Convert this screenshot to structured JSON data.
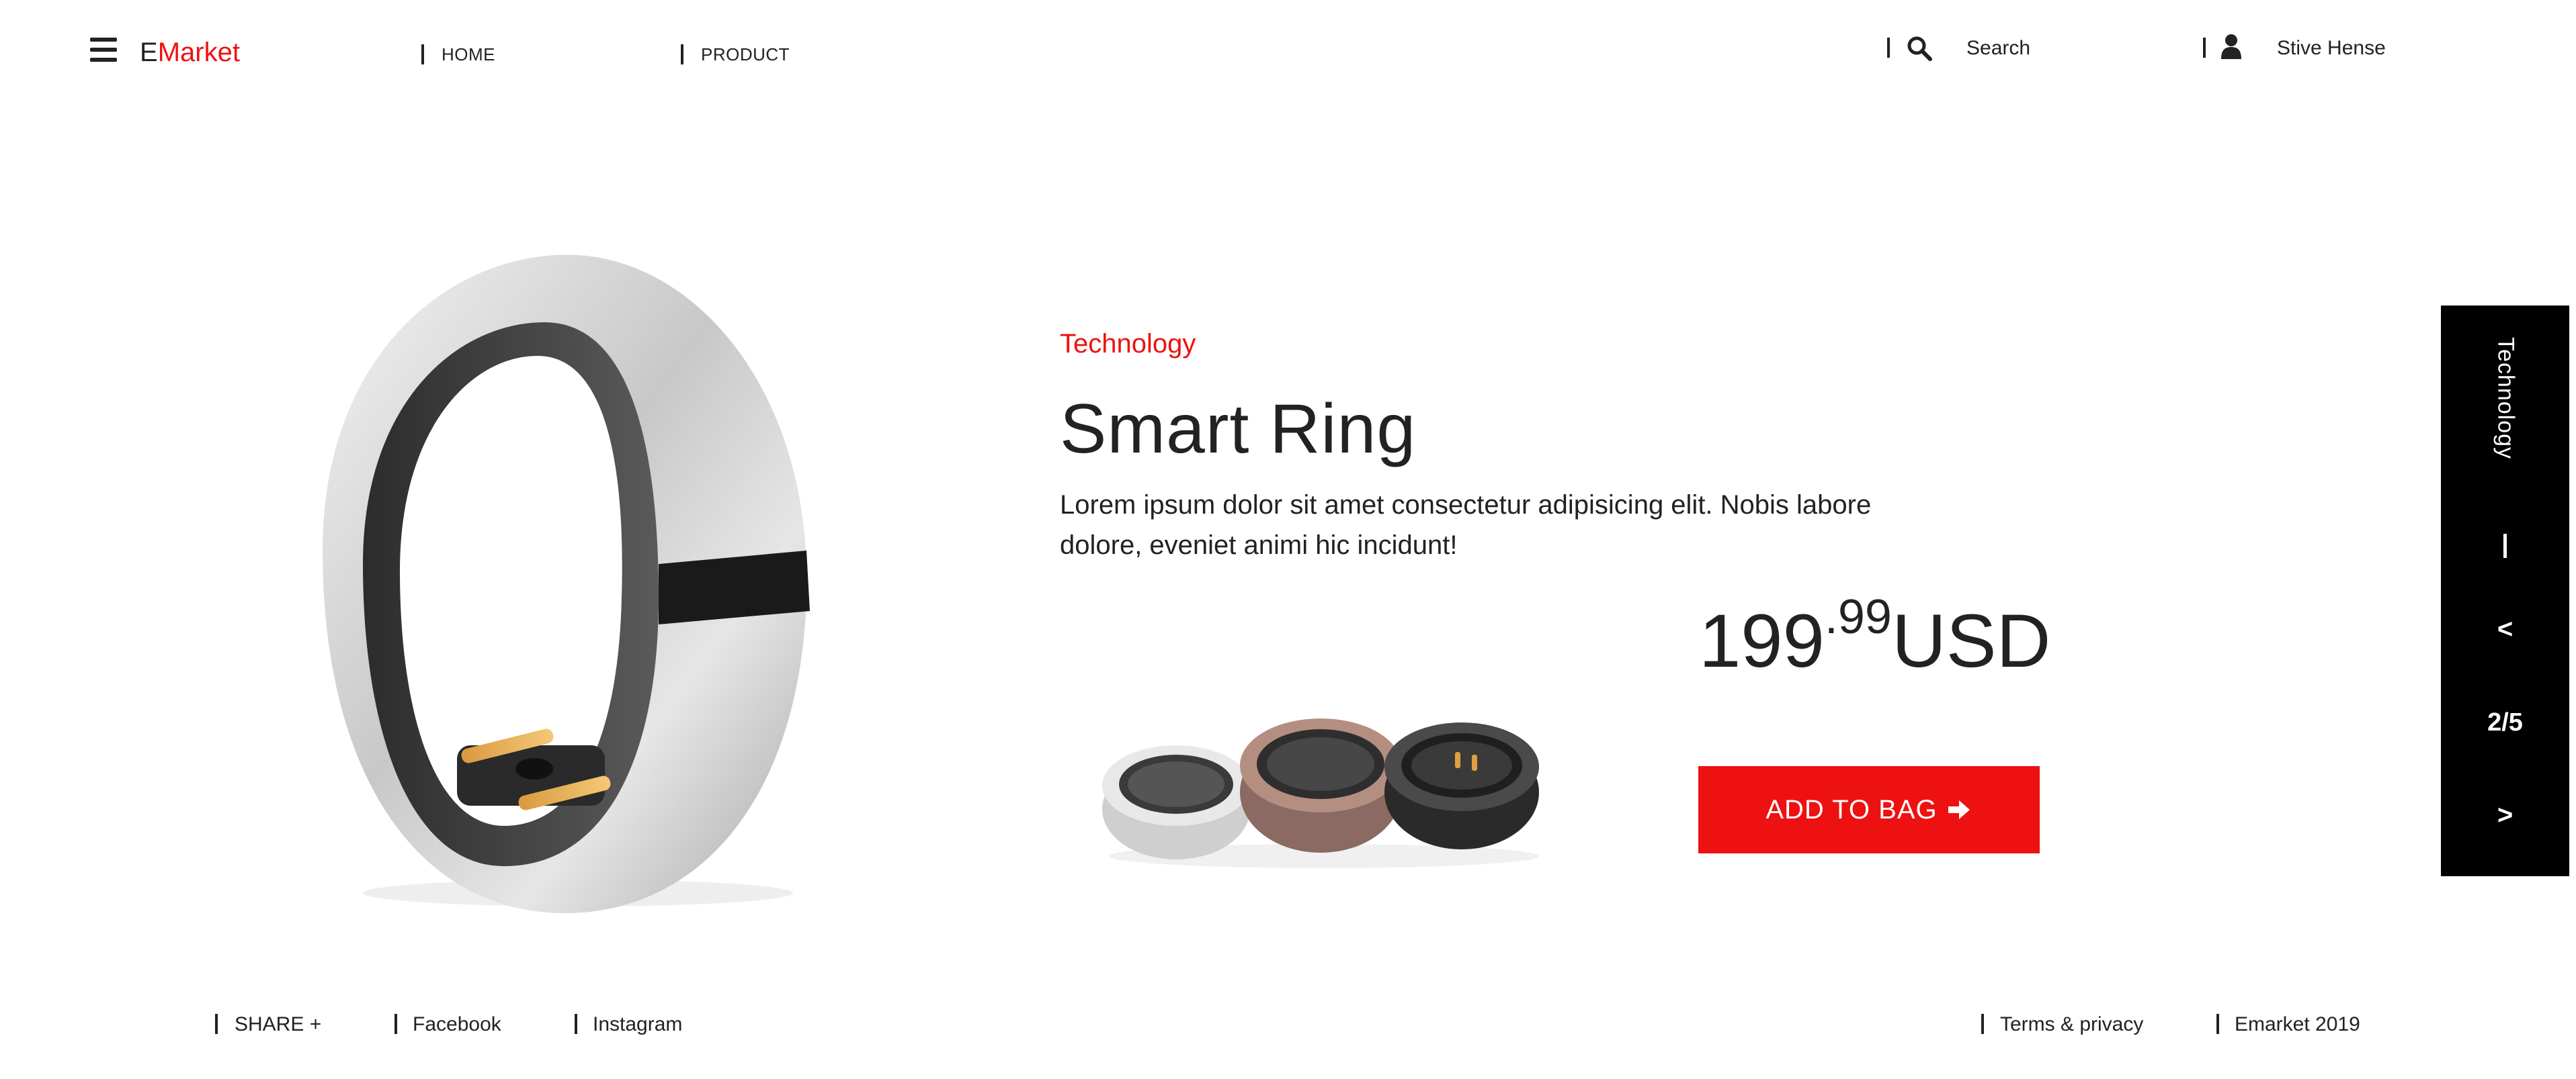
{
  "header": {
    "logo_first": "E",
    "logo_rest": "Market",
    "nav": {
      "home": "HOME",
      "product": "PRODUCT"
    },
    "search_placeholder": "Search",
    "user_name": "Stive Hense",
    "icons": {
      "menu": "hamburger-icon",
      "search": "search-icon",
      "user": "user-icon"
    }
  },
  "product": {
    "category": "Technology",
    "name": "Smart Ring",
    "description": "Lorem ipsum dolor sit amet consectetur adipisicing elit. Nobis labore dolore, eveniet animi hic incidunt!",
    "price_whole": "199",
    "price_cents": ".99",
    "currency": "USD",
    "add_to_bag": "ADD TO BAG"
  },
  "slider": {
    "category": "Technology",
    "prev": "<",
    "counter": "2/5",
    "next": ">"
  },
  "footer": {
    "share": "SHARE +",
    "facebook": "Facebook",
    "instagram": "Instagram",
    "terms": "Terms & privacy",
    "copyright": "Emarket 2019"
  },
  "colors": {
    "accent": "#ee1111",
    "dark": "#222222",
    "panel": "#000000"
  }
}
